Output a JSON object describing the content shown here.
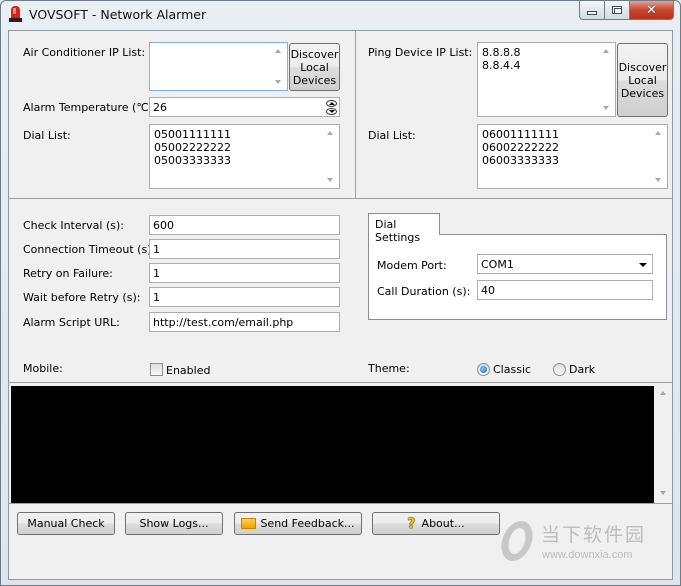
{
  "window": {
    "title": "VOVSOFT - Network Alarmer",
    "controls": {
      "minimize": "minimize",
      "maximize": "maximize",
      "close": "✕"
    }
  },
  "air_conditioner": {
    "ip_list_label": "Air Conditioner IP List:",
    "ip_list": [],
    "discover_button": [
      "Discover",
      "Local",
      "Devices"
    ],
    "alarm_temp_label": "Alarm Temperature (℃):",
    "alarm_temp_value": "26",
    "dial_list_label": "Dial List:",
    "dial_list": [
      "05001111111",
      "05002222222",
      "05003333333"
    ]
  },
  "ping": {
    "ip_list_label": "Ping Device IP List:",
    "ip_list": [
      "8.8.8.8",
      "8.8.4.4"
    ],
    "discover_button": [
      "Discover",
      "Local",
      "Devices"
    ],
    "dial_list_label": "Dial List:",
    "dial_list": [
      "06001111111",
      "06002222222",
      "06003333333"
    ]
  },
  "settings": {
    "check_interval_label": "Check Interval (s):",
    "check_interval": "600",
    "connection_timeout_label": "Connection Timeout (s):",
    "connection_timeout": "1",
    "retry_label": "Retry on Failure:",
    "retry": "1",
    "wait_label": "Wait before Retry (s):",
    "wait": "1",
    "script_url_label": "Alarm Script URL:",
    "script_url": "http://test.com/email.php"
  },
  "dial_settings": {
    "tab_label": "Dial Settings",
    "modem_port_label": "Modem Port:",
    "modem_port": "COM1",
    "call_duration_label": "Call Duration (s):",
    "call_duration": "40"
  },
  "mobile": {
    "label": "Mobile:",
    "checkbox_label": "Enabled",
    "checked": false
  },
  "theme": {
    "label": "Theme:",
    "options": [
      "Classic",
      "Dark"
    ],
    "selected": "Classic"
  },
  "log": {
    "text": ""
  },
  "buttons": {
    "manual_check": "Manual Check",
    "show_logs": "Show Logs...",
    "send_feedback": "Send Feedback...",
    "about": "About..."
  },
  "watermark": {
    "cn": "当下软件园",
    "url": "www.downxia.com"
  }
}
